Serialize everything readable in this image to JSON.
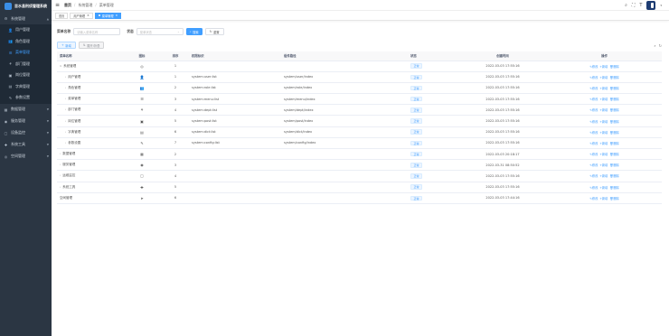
{
  "brand": {
    "title": "吉水县刑侦管理系统"
  },
  "sidebar": {
    "items": [
      {
        "label": "系统管理",
        "icon": "gear-icon",
        "glyph": "⚙",
        "level": 1,
        "expanded": true
      },
      {
        "label": "用户管理",
        "icon": "user-icon",
        "glyph": "👤",
        "level": 2
      },
      {
        "label": "角色管理",
        "icon": "role-icon",
        "glyph": "👥",
        "level": 2
      },
      {
        "label": "菜单管理",
        "icon": "menu-tree-icon",
        "glyph": "☰",
        "level": 2,
        "active": true
      },
      {
        "label": "部门管理",
        "icon": "dept-icon",
        "glyph": "⚘",
        "level": 2
      },
      {
        "label": "岗位管理",
        "icon": "post-icon",
        "glyph": "▣",
        "level": 2
      },
      {
        "label": "字典管理",
        "icon": "dict-icon",
        "glyph": "▤",
        "level": 2
      },
      {
        "label": "参数设置",
        "icon": "edit-icon",
        "glyph": "✎",
        "level": 2
      },
      {
        "label": "数据管理",
        "icon": "data-icon",
        "glyph": "▦",
        "level": 1
      },
      {
        "label": "服务管理",
        "icon": "monitor-icon",
        "glyph": "◉",
        "level": 1
      },
      {
        "label": "设备监控",
        "icon": "device-icon",
        "glyph": "▢",
        "level": 1
      },
      {
        "label": "系统工具",
        "icon": "tool-icon",
        "glyph": "✚",
        "level": 1
      },
      {
        "label": "空间管理",
        "icon": "globe-icon",
        "glyph": "◎",
        "level": 1
      }
    ]
  },
  "topbar": {
    "breadcrumb": [
      "首页",
      "系统管理",
      "菜单管理"
    ],
    "icons": [
      "search-icon",
      "fullscreen-icon",
      "font-size-icon"
    ]
  },
  "tags": [
    {
      "label": "首页",
      "active": false
    },
    {
      "label": "用户管理",
      "active": false,
      "closable": true
    },
    {
      "label": "菜单管理",
      "active": true,
      "closable": true
    }
  ],
  "search": {
    "name_label": "菜单名称",
    "name_placeholder": "请输入菜单名称",
    "status_label": "状态",
    "status_placeholder": "菜单状态",
    "search_btn": "搜索",
    "reset_btn": "重置"
  },
  "actions": {
    "add": "新增",
    "expand": "展开/折叠"
  },
  "table": {
    "headers": [
      "菜单名称",
      "图标",
      "排序",
      "权限标识",
      "组件路径",
      "状态",
      "创建时间",
      "操作"
    ],
    "rows": [
      {
        "name": "系统管理",
        "indent": 0,
        "arrow": "∨",
        "icon": "◎",
        "sort": "1",
        "perm": "",
        "path": "",
        "status": "正常",
        "time": "2022-03-03 17:55:16",
        "ops": [
          "修改",
          "新增",
          "删除"
        ]
      },
      {
        "name": "用户管理",
        "indent": 1,
        "arrow": "›",
        "icon": "👤",
        "sort": "1",
        "perm": "system:user:list",
        "path": "system/user/index",
        "status": "正常",
        "time": "2022-03-03 17:55:16",
        "ops": [
          "修改",
          "新增",
          "删除"
        ]
      },
      {
        "name": "角色管理",
        "indent": 1,
        "arrow": "›",
        "icon": "👥",
        "sort": "2",
        "perm": "system:role:list",
        "path": "system/role/index",
        "status": "正常",
        "time": "2022-03-03 17:55:16",
        "ops": [
          "修改",
          "新增",
          "删除"
        ]
      },
      {
        "name": "菜单管理",
        "indent": 1,
        "arrow": "›",
        "icon": "☰",
        "sort": "3",
        "perm": "system:menu:list",
        "path": "system/menu/index",
        "status": "正常",
        "time": "2022-03-03 17:55:16",
        "ops": [
          "修改",
          "新增",
          "删除"
        ]
      },
      {
        "name": "部门管理",
        "indent": 1,
        "arrow": "›",
        "icon": "⚘",
        "sort": "4",
        "perm": "system:dept:list",
        "path": "system/dept/index",
        "status": "正常",
        "time": "2022-03-03 17:55:16",
        "ops": [
          "修改",
          "新增",
          "删除"
        ]
      },
      {
        "name": "岗位管理",
        "indent": 1,
        "arrow": "›",
        "icon": "▣",
        "sort": "5",
        "perm": "system:post:list",
        "path": "system/post/index",
        "status": "正常",
        "time": "2022-03-03 17:55:16",
        "ops": [
          "修改",
          "新增",
          "删除"
        ]
      },
      {
        "name": "字典管理",
        "indent": 1,
        "arrow": "›",
        "icon": "▤",
        "sort": "6",
        "perm": "system:dict:list",
        "path": "system/dict/index",
        "status": "正常",
        "time": "2022-03-03 17:55:16",
        "ops": [
          "修改",
          "新增",
          "删除"
        ]
      },
      {
        "name": "参数设置",
        "indent": 1,
        "arrow": "›",
        "icon": "✎",
        "sort": "7",
        "perm": "system:config:list",
        "path": "system/config/index",
        "status": "正常",
        "time": "2022-03-03 17:55:16",
        "ops": [
          "修改",
          "新增",
          "删除"
        ]
      },
      {
        "name": "数据管理",
        "indent": 0,
        "arrow": "›",
        "icon": "▦",
        "sort": "2",
        "perm": "",
        "path": "",
        "status": "正常",
        "time": "2022-03-03 20:18:17",
        "ops": [
          "修改",
          "新增",
          "删除"
        ]
      },
      {
        "name": "服务管理",
        "indent": 0,
        "arrow": "›",
        "icon": "◉",
        "sort": "3",
        "perm": "",
        "path": "",
        "status": "正常",
        "time": "2022-03-31 08:50:52",
        "ops": [
          "修改",
          "新增",
          "删除"
        ]
      },
      {
        "name": "运维监控",
        "indent": 0,
        "arrow": "›",
        "icon": "▢",
        "sort": "4",
        "perm": "",
        "path": "",
        "status": "正常",
        "time": "2022-03-03 17:55:16",
        "ops": [
          "修改",
          "新增",
          "删除"
        ]
      },
      {
        "name": "系统工具",
        "indent": 0,
        "arrow": "›",
        "icon": "✚",
        "sort": "5",
        "perm": "",
        "path": "",
        "status": "正常",
        "time": "2022-03-03 17:55:16",
        "ops": [
          "修改",
          "新增",
          "删除"
        ]
      },
      {
        "name": "空间管理",
        "indent": 0,
        "arrow": "",
        "icon": "➤",
        "sort": "6",
        "perm": "",
        "path": "",
        "status": "正常",
        "time": "2022-03-03 17:44:16",
        "ops": [
          "修改",
          "新增",
          "删除"
        ]
      }
    ]
  },
  "colors": {
    "sidebar_bg": "#2b3643",
    "accent": "#409eff"
  }
}
